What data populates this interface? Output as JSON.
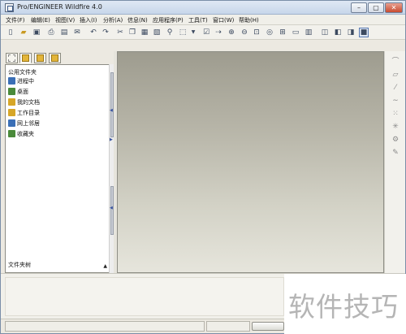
{
  "window": {
    "title": "Pro/ENGINEER Wildfire 4.0",
    "controls": {
      "minimize": "–",
      "maximize": "▢",
      "close": "✕"
    }
  },
  "menu": [
    {
      "label": "文件(F)"
    },
    {
      "label": "编辑(E)"
    },
    {
      "label": "视图(V)"
    },
    {
      "label": "插入(I)"
    },
    {
      "label": "分析(A)"
    },
    {
      "label": "信息(N)"
    },
    {
      "label": "应用程序(P)"
    },
    {
      "label": "工具(T)"
    },
    {
      "label": "窗口(W)"
    },
    {
      "label": "帮助(H)"
    }
  ],
  "toolbar": {
    "icons": [
      "new-icon",
      "open-icon",
      "save-icon",
      "print-icon",
      "print-preview-icon",
      "email-icon",
      "undo-icon",
      "redo-icon",
      "cut-icon",
      "copy-icon",
      "paste-icon",
      "paste-special-icon",
      "find-icon",
      "select-box-icon",
      "dropdown-icon",
      "regenerate-icon",
      "datum-icon",
      "zoom-in-icon",
      "zoom-out-icon",
      "refit-icon",
      "spin-center-icon",
      "orient-icon",
      "saved-views-icon",
      "layers-icon",
      "shading-icon",
      "hidden-line-icon",
      "no-hidden-icon",
      "wireframe-icon"
    ]
  },
  "navigator": {
    "header": "公用文件夹",
    "items": [
      {
        "label": "进程中",
        "icon": "session-icon",
        "color": "#3b6fb6"
      },
      {
        "label": "桌面",
        "icon": "desktop-icon",
        "color": "#4a8a3a"
      },
      {
        "label": "我的文档",
        "icon": "my-documents-icon",
        "color": "#d6a628"
      },
      {
        "label": "工作目录",
        "icon": "working-directory-icon",
        "color": "#d6a628"
      },
      {
        "label": "网上邻居",
        "icon": "network-icon",
        "color": "#3b6fb6"
      },
      {
        "label": "收藏夹",
        "icon": "favorites-icon",
        "color": "#4a8a3a"
      }
    ],
    "footer": "文件夹树",
    "footer_arrow": "▲"
  },
  "sketch_tools": {
    "icons": [
      "sketch-mode-icon",
      "dimension-icon",
      "constraint-icon",
      "done-sketch-icon"
    ]
  },
  "nav_tabs": {
    "icons": [
      "model-tree-tab-icon",
      "folder-browser-tab-icon",
      "favorites-tab-icon",
      "connections-tab-icon"
    ]
  },
  "right_toolbar": {
    "icons": [
      "arc-icon",
      "plane-icon",
      "axis-icon",
      "curve-icon",
      "point-icon",
      "csys-icon",
      "analysis-icon",
      "sketched-curve-icon"
    ]
  },
  "watermark": {
    "text": "软件技巧"
  },
  "colors": {
    "accent": "#3b6fb6",
    "graphics_top": "#9e9c8f",
    "graphics_bottom": "#e6e5dc"
  }
}
